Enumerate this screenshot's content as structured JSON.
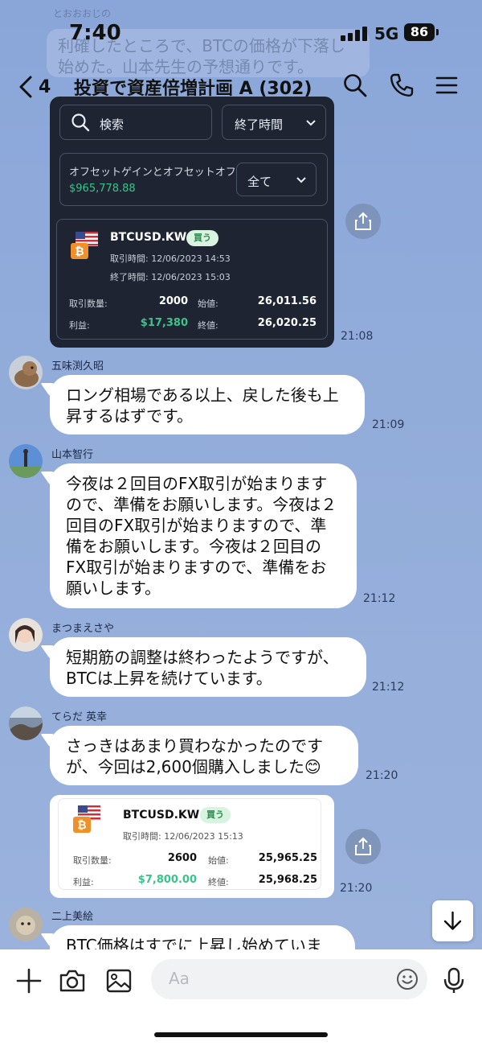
{
  "status_bar": {
    "time": "7:40",
    "network": "5G",
    "battery": "86"
  },
  "ghost": {
    "name": "とおおおじの",
    "text": "利確したところで、BTCの価格が下落し始めた。山本先生の予想通りです。"
  },
  "header": {
    "back_count": "4",
    "title": "投資で資産倍増計画 A (302)"
  },
  "trade_card_1": {
    "search_placeholder": "検索",
    "sort_label": "終了時間",
    "offset_label": "オフセットゲインとオフセットオフ",
    "offset_value": "$965,778.88",
    "filter_label": "全て",
    "symbol": "BTCUSD.KW",
    "badge": "買う",
    "open_time": "取引時間: 12/06/2023 14:53",
    "close_time": "終了時間: 12/06/2023 15:03",
    "qty_label": "取引数量:",
    "qty": "2000",
    "open_label": "始値:",
    "open_price": "26,011.56",
    "profit_label": "利益:",
    "profit": "$17,380",
    "close_label": "終値:",
    "close_price": "26,020.25",
    "time": "21:08"
  },
  "messages": [
    {
      "sender": "五味渕久昭",
      "text": "ロング相場である以上、戻した後も上昇するはずです。",
      "time": "21:09"
    },
    {
      "sender": "山本智行",
      "text": "今夜は２回目のFX取引が始まりますので、準備をお願いします。今夜は２回目のFX取引が始まりますので、準備をお願いします。今夜は２回目のFX取引が始まりますので、準備をお願いします。",
      "time": "21:12"
    },
    {
      "sender": "まつまえさや",
      "text": "短期筋の調整は終わったようですが、BTCは上昇を続けています。",
      "time": "21:12"
    },
    {
      "sender": "てらだ 英幸",
      "text": "さっきはあまり買わなかったのですが、今回は2,600個購入しました😊",
      "time": "21:20"
    },
    {
      "sender": "二上美絵",
      "text": "BTC価格はすでに上昇し始めていま"
    }
  ],
  "trade_card_2": {
    "symbol": "BTCUSD.KW",
    "badge": "買う",
    "open_time": "取引時間: 12/06/2023 15:13",
    "qty_label": "取引数量:",
    "qty": "2600",
    "open_label": "始値:",
    "open_price": "25,965.25",
    "profit_label": "利益:",
    "profit": "$7,800.00",
    "close_label": "終値:",
    "close_price": "25,968.25",
    "time": "21:20"
  },
  "input": {
    "placeholder": "Aa"
  },
  "colors": {
    "profit_green": "#3bc48a",
    "chat_bg": "#8fa9d8",
    "card_dark": "#1e2431"
  },
  "icons": [
    "back-chevron-icon",
    "search-icon",
    "phone-icon",
    "menu-icon",
    "share-icon",
    "scroll-down-icon",
    "plus-icon",
    "camera-icon",
    "image-icon",
    "emoji-icon",
    "mic-icon"
  ]
}
